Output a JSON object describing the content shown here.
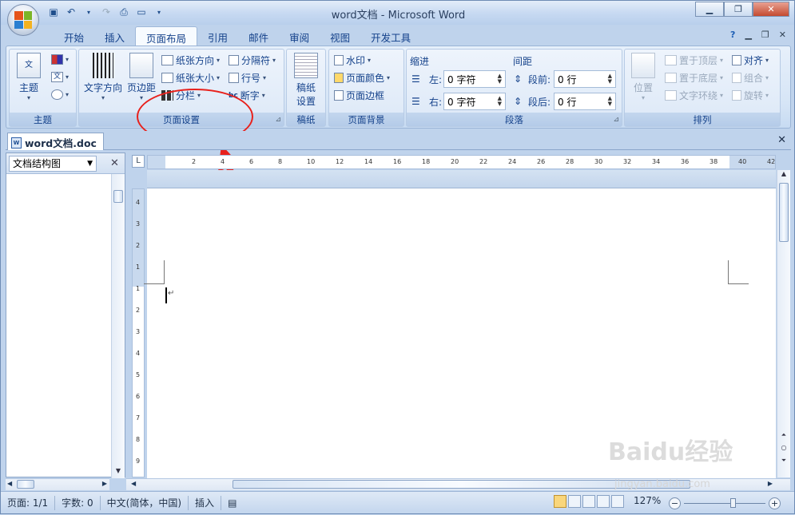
{
  "window": {
    "title": "word文档 - Microsoft Word"
  },
  "tabs": [
    "开始",
    "插入",
    "页面布局",
    "引用",
    "邮件",
    "审阅",
    "视图",
    "开发工具"
  ],
  "active_tab": "页面布局",
  "ribbon": {
    "theme_group": {
      "label": "主题",
      "theme_button": "主题"
    },
    "page_setup": {
      "label": "页面设置",
      "text_direction": "文字方向",
      "margins": "页边距",
      "orientation": "纸张方向",
      "size": "纸张大小",
      "columns": "分栏",
      "breaks": "分隔符",
      "line_numbers": "行号",
      "hyphenation": "断字"
    },
    "manuscript": {
      "label": "稿纸",
      "button": "稿纸\n设置",
      "line1": "稿纸",
      "line2": "设置"
    },
    "page_background": {
      "label": "页面背景",
      "watermark": "水印",
      "page_color": "页面颜色",
      "page_borders": "页面边框"
    },
    "paragraph": {
      "label": "段落",
      "indent_title": "缩进",
      "spacing_title": "间距",
      "left_label": "左:",
      "right_label": "右:",
      "before_label": "段前:",
      "after_label": "段后:",
      "left_value": "0 字符",
      "right_value": "0 字符",
      "before_value": "0 行",
      "after_value": "0 行"
    },
    "arrange": {
      "label": "排列",
      "position": "位置",
      "bring_front": "置于顶层",
      "send_back": "置于底层",
      "text_wrap": "文字环绕",
      "align": "对齐",
      "group": "组合",
      "rotate": "旋转"
    }
  },
  "document_tab": "word文档.doc",
  "nav_pane": {
    "selector": "文档结构图"
  },
  "ruler": {
    "h_ticks": [
      "2",
      "4",
      "6",
      "8",
      "10",
      "12",
      "14",
      "16",
      "18",
      "20",
      "22",
      "24",
      "26",
      "28",
      "30",
      "32",
      "34",
      "36",
      "38",
      "40",
      "42"
    ],
    "v_ticks": [
      "4",
      "3",
      "2",
      "1",
      "1",
      "2",
      "3",
      "4",
      "5",
      "6",
      "7",
      "8",
      "9"
    ]
  },
  "status": {
    "page": "页面: 1/1",
    "words": "字数: 0",
    "language": "中文(简体，中国)",
    "mode": "插入",
    "zoom": "127%"
  },
  "watermark_text": {
    "brand": "Baidu经验",
    "url": "jingyan.baidu.com"
  },
  "colors": {
    "annotation": "#e8211c",
    "ribbon_bg": "#d6e5f6",
    "accent": "#15428b"
  }
}
